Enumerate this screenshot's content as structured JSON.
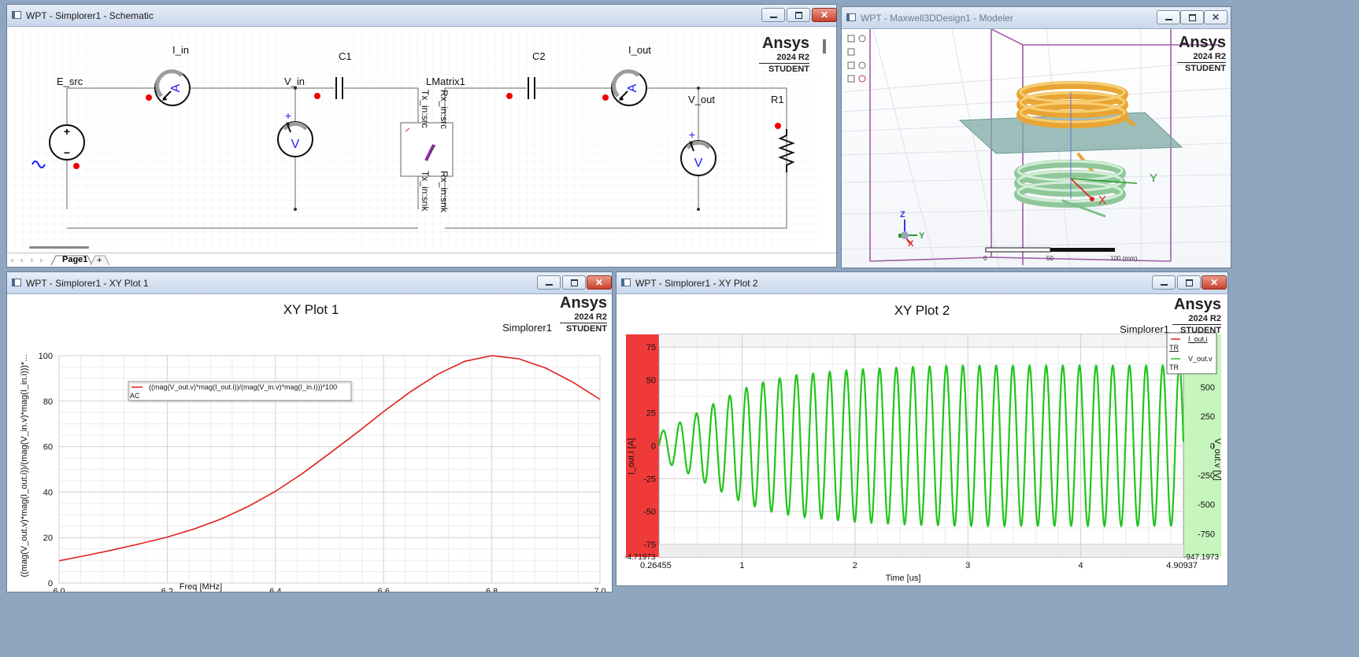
{
  "windows": {
    "schematic": {
      "title": "WPT - Simplorer1 - Schematic"
    },
    "modeler": {
      "title": "WPT - Maxwell3DDesign1 - Modeler"
    },
    "plot1": {
      "title": "WPT - Simplorer1 - XY Plot 1"
    },
    "plot2": {
      "title": "WPT - Simplorer1 - XY Plot 2"
    }
  },
  "brand": {
    "name": "Ansys",
    "version": "2024 R2",
    "edition": "STUDENT"
  },
  "schematic": {
    "labels": {
      "e_src": "E_src",
      "i_in": "I_in",
      "v_in": "V_in",
      "c1": "C1",
      "matrix": "LMatrix1",
      "c2": "C2",
      "i_out": "I_out",
      "v_out": "V_out",
      "r1": "R1"
    },
    "pins": {
      "tx_src": "Tx_in:src",
      "rx_src": "Rx_in:src",
      "tx_snk": "Tx_in:snk",
      "rx_snk": "Rx_in:snk"
    },
    "meter_a": "A",
    "meter_v": "V",
    "plus": "+",
    "minus": "−",
    "page_tab": "Page1",
    "add_tab": "+"
  },
  "modeler": {
    "axes": {
      "x": "X",
      "y": "Y",
      "z": "Z"
    },
    "scale": {
      "start": "0",
      "mid": "50",
      "end": "100 (mm)"
    }
  },
  "plot1": {
    "title": "XY Plot 1",
    "source": "Simplorer1",
    "legend": {
      "expr": "((mag(V_out.v)*mag(I_out.i))/(mag(V_in.v)*mag(I_in.i)))*100",
      "sub": "AC"
    },
    "xlabel": "Freq [MHz]",
    "ylabel": "((mag(V_out.v)*mag(I_out.i))/(mag(V_in.v)*mag(I_in.i)))*...",
    "colors": {
      "curve": "#e02020"
    }
  },
  "plot2": {
    "title": "XY Plot 2",
    "source": "Simplorer1",
    "legend": [
      {
        "name": "I_out.i",
        "sub": "TR"
      },
      {
        "name": "V_out.v",
        "sub": "TR"
      }
    ],
    "xlabel": "Time [us]",
    "ylabel_left": "I_out.i [A]",
    "ylabel_right": "V_out.v [V]",
    "xticks": [
      "0.26455",
      "1",
      "2",
      "3",
      "4",
      "4.90937"
    ],
    "yticks_left": [
      "75",
      "50",
      "25",
      "0",
      "-25",
      "-50",
      "-75"
    ],
    "yticks_right": [
      "500",
      "250",
      "0",
      "-250",
      "-500",
      "-750"
    ],
    "ymin_left_label": "-4.71973",
    "ymin_right_label": "-947.1973",
    "colors": {
      "i_out": "#e02020",
      "v_out": "#22c41c",
      "left_band": "#f03a3a",
      "right_band": "#c6f5bd"
    }
  },
  "chart_data": [
    {
      "type": "line",
      "title": "XY Plot 1",
      "xlabel": "Freq [MHz]",
      "ylabel": "((mag(V_out.v)*mag(I_out.i))/(mag(V_in.v)*mag(I_in.i)))*...",
      "xlim": [
        6.0,
        7.0
      ],
      "ylim": [
        0,
        100
      ],
      "xticks": [
        6.0,
        6.2,
        6.4,
        6.6,
        6.8,
        7.0
      ],
      "yticks": [
        0,
        20,
        40,
        60,
        80,
        100
      ],
      "grid": true,
      "legend": "top-left",
      "series": [
        {
          "name": "((mag(V_out.v)*mag(I_out.i))/(mag(V_in.v)*mag(I_in.i)))*100",
          "x": [
            6.0,
            6.05,
            6.1,
            6.15,
            6.2,
            6.25,
            6.3,
            6.35,
            6.4,
            6.45,
            6.5,
            6.55,
            6.6,
            6.65,
            6.7,
            6.75,
            6.8,
            6.85,
            6.9,
            6.95,
            7.0
          ],
          "y": [
            9.8,
            12.1,
            14.6,
            17.3,
            20.2,
            23.8,
            28.2,
            33.7,
            40.3,
            48.2,
            57.0,
            66.0,
            75.4,
            84.2,
            91.8,
            97.5,
            100.0,
            98.6,
            94.5,
            88.3,
            80.8
          ]
        }
      ]
    },
    {
      "type": "line",
      "title": "XY Plot 2",
      "xlabel": "Time [us]",
      "ylabel": "I_out.i [A]",
      "ylabel_right": "V_out.v [V]",
      "xlim": [
        0.26455,
        4.90937
      ],
      "ylim": [
        -84.71973,
        84.71973
      ],
      "ylim_right": [
        -947.1973,
        947.1973
      ],
      "grid": true,
      "legend": "top-right",
      "frequency_mhz": 6.78,
      "series": [
        {
          "name": "I_out.i",
          "axis": "left",
          "envelope_t": [
            0.26455,
            0.5,
            0.75,
            1.0,
            1.25,
            1.5,
            2.0,
            2.5,
            3.0,
            4.0,
            4.90937
          ],
          "envelope_amp": [
            10,
            20,
            32,
            43,
            50,
            54,
            58,
            60,
            61,
            61,
            61
          ]
        },
        {
          "name": "V_out.v",
          "axis": "right",
          "envelope_t": [
            0.26455,
            0.5,
            0.75,
            1.0,
            1.25,
            1.5,
            2.0,
            2.5,
            3.0,
            4.0,
            4.90937
          ],
          "envelope_amp": [
            112,
            224,
            358,
            481,
            559,
            604,
            648,
            671,
            682,
            682,
            682
          ]
        }
      ]
    }
  ]
}
